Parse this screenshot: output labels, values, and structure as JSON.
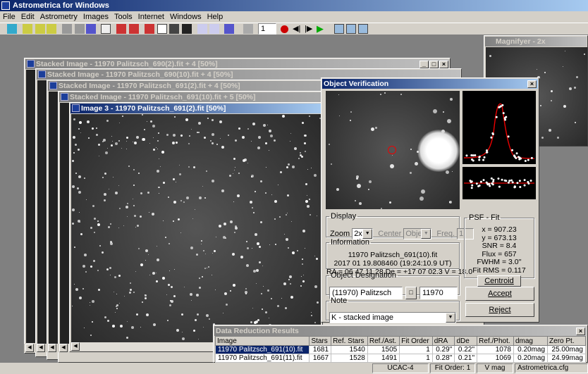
{
  "app": {
    "title": "Astrometrica for Windows"
  },
  "menu": [
    "File",
    "Edit",
    "Astrometry",
    "Images",
    "Tools",
    "Internet",
    "Windows",
    "Help"
  ],
  "toolbar": {
    "spin_value": "1"
  },
  "windows": {
    "w1": "Stacked Image - 11970 Palitzsch_690(2).fit + 4 [50%]",
    "w2": "Stacked Image - 11970 Palitzsch_690(10).fit + 4 [50%]",
    "w3": "Stacked Image - 11970 Palitzsch_691(2).fit + 4 [50%]",
    "w4": "Stacked Image - 11970 Palitzsch_691(10).fit + 5 [50%]",
    "w5": "Image 3 - 11970 Palitzsch_691(2).fit [50%]",
    "magnifier": "Magnifyer - 2x",
    "obj": "Object Verification"
  },
  "display": {
    "legend": "Display",
    "zoom_label": "Zoom",
    "zoom_value": "2x",
    "center_label": "Center",
    "center_value": "Object",
    "freq_label": "Freq.",
    "freq_value": "1"
  },
  "information": {
    "legend": "Information",
    "file": "11970 Palitzsch_691(10).fit",
    "date": "2017 01 19.808460 (19:24:10.9 UT)",
    "coords": "RA = 06 47 11.28    De = +17 07 02.3    V = 18.0"
  },
  "designation": {
    "legend": "Object Designation",
    "name": "(11970) Palitzsch",
    "number": "11970"
  },
  "note": {
    "legend": "Note",
    "value": "K - stacked image"
  },
  "psf": {
    "legend": "PSF - Fit",
    "x": "x = 907.23",
    "y": "y = 673.13",
    "snr": "SNR = 8.4",
    "flux": "Flux = 657",
    "fwhm": "FWHM = 3.0''",
    "rms": "Fit RMS = 0.117",
    "centroid": "Centroid"
  },
  "buttons": {
    "accept": "Accept",
    "reject": "Reject"
  },
  "results": {
    "title": "Data Reduction Results",
    "headers": [
      "Image",
      "Stars",
      "Ref. Stars",
      "Ref./Ast.",
      "Fit Order",
      "dRA",
      "dDe",
      "Ref./Phot.",
      "dmag",
      "Zero Pt."
    ],
    "rows": [
      [
        "11970 Palitzsch_691(10).fit",
        "1681",
        "1540",
        "1505",
        "1",
        "0.29''",
        "0.22''",
        "1078",
        "0.20mag",
        "25.00mag"
      ],
      [
        "11970 Palitzsch_691(11).fit",
        "1667",
        "1528",
        "1491",
        "1",
        "0.28''",
        "0.21''",
        "1069",
        "0.20mag",
        "24.99mag"
      ]
    ]
  },
  "status": {
    "catalog": "UCAC-4",
    "fitorder": "Fit Order: 1",
    "band": "V mag",
    "config": "Astrometrica.cfg"
  }
}
